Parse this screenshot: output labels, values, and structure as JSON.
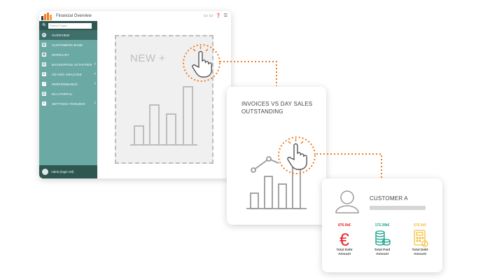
{
  "app": {
    "title": "Financial Overview",
    "titlebar_icons": [
      "window-icon",
      "help-icon",
      "menu-icon"
    ]
  },
  "search": {
    "placeholder": "Search Pages"
  },
  "sidebar": {
    "items": [
      {
        "label": "OVERVIEW",
        "icon": "eye-icon",
        "active": true,
        "has_submenu": false
      },
      {
        "label": "CUSTOMERS BASE",
        "icon": "customers-icon",
        "active": false,
        "has_submenu": false
      },
      {
        "label": "WORKLIST",
        "icon": "worklist-icon",
        "active": false,
        "has_submenu": false
      },
      {
        "label": "BACKOFFICE ACTIVITIES",
        "icon": "backoffice-icon",
        "active": false,
        "has_submenu": true
      },
      {
        "label": "AD-HOC ANALYSIS",
        "icon": "analysis-icon",
        "active": false,
        "has_submenu": true
      },
      {
        "label": "PERFORMANCE",
        "icon": "performance-icon",
        "active": false,
        "has_submenu": true
      },
      {
        "label": "DCA PORTAL",
        "icon": "portal-icon",
        "active": false,
        "has_submenu": false
      },
      {
        "label": "SETTINGS TOOLBOX",
        "icon": "tools-icon",
        "active": false,
        "has_submenu": true
      }
    ],
    "user": "Admin (login Ctrl)"
  },
  "new_widget": {
    "label": "NEW +"
  },
  "invoices_card": {
    "title": "INVOICES VS DAY SALES OUTSTANDING"
  },
  "customer_card": {
    "name": "CUSTOMER A",
    "metrics": [
      {
        "value": "876.9k€",
        "label_line1": "Total Debt",
        "label_line2": "Amount",
        "color": "#e8262b",
        "icon": "euro-icon"
      },
      {
        "value": "172.39k€",
        "label_line1": "Total Paid",
        "label_line2": "Amount",
        "color": "#1aa38c",
        "icon": "coins-icon"
      },
      {
        "value": "876.9k€",
        "label_line1": "Total Debt",
        "label_line2": "Amount",
        "color": "#f5c242",
        "icon": "calculator-icon"
      }
    ]
  },
  "colors": {
    "sidebar": "#6ba9a4",
    "sidebar_dark": "#2f5752",
    "accent": "#f07c20"
  }
}
